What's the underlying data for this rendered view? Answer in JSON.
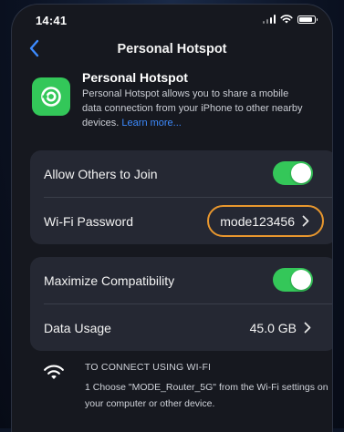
{
  "status_bar": {
    "time": "14:41",
    "icons": [
      "signal-icon",
      "wifi-icon",
      "battery-icon"
    ]
  },
  "nav": {
    "back_icon": "chevron-left-icon",
    "title": "Personal Hotspot"
  },
  "header": {
    "icon": "hotspot-link-icon",
    "title": "Personal Hotspot",
    "description": "Personal Hotspot allows you to share a mobile data connection from your iPhone to other nearby devices.",
    "link_text": "Learn more..."
  },
  "settings": {
    "allow_others": {
      "label": "Allow Others to Join",
      "enabled": true
    },
    "wifi_password": {
      "label": "Wi-Fi Password",
      "value": "mode123456"
    },
    "maximize_compat": {
      "label": "Maximize Compatibility",
      "enabled": true
    },
    "data_usage": {
      "label": "Data Usage",
      "value": "45.0 GB"
    }
  },
  "connect_info": {
    "icon": "wifi-icon",
    "heading": "TO CONNECT USING WI-FI",
    "text": "1 Choose \"MODE_Router_5G\" from the Wi-Fi settings on your computer or other device."
  },
  "colors": {
    "toggle_on": "#34c759",
    "link": "#3d8bff",
    "highlight_ring": "#e8972e",
    "app_icon_bg": "#33c759"
  }
}
